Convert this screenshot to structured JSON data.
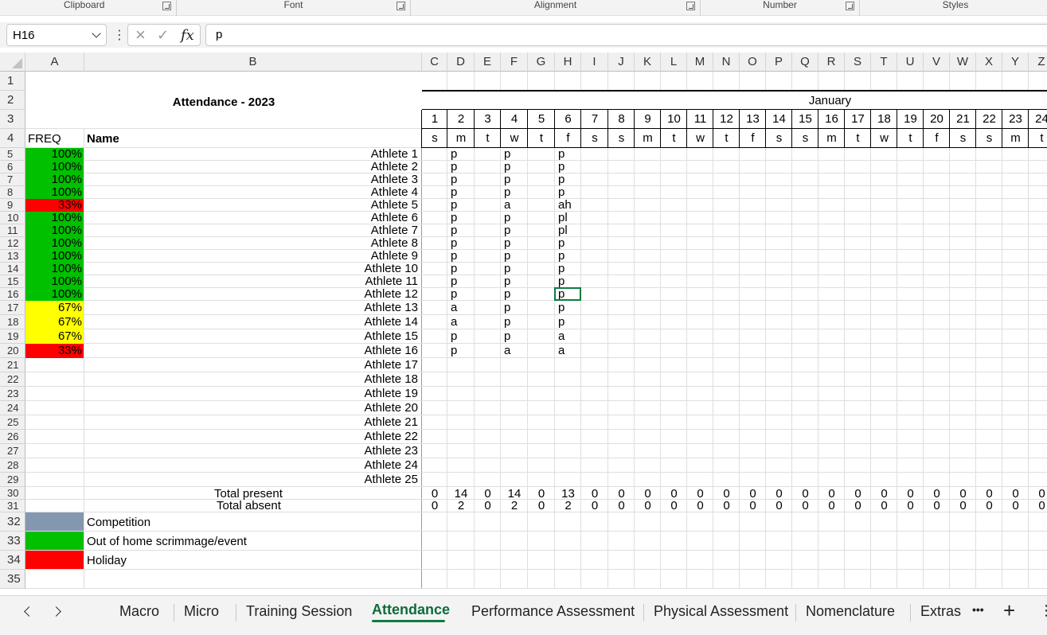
{
  "ribbon": {
    "groups": [
      {
        "label": "Clipboard"
      },
      {
        "label": "Font"
      },
      {
        "label": "Alignment"
      },
      {
        "label": "Number"
      },
      {
        "label": "Styles"
      }
    ]
  },
  "formula_bar": {
    "name_box": "H16",
    "more_icon": "⋮",
    "cancel_icon": "×",
    "enter_icon": "✓",
    "function_icon": "fx",
    "formula": "p"
  },
  "sheet": {
    "columns": [
      "A",
      "B",
      "C",
      "D",
      "E",
      "F",
      "G",
      "H",
      "I",
      "J",
      "K",
      "L",
      "M",
      "N",
      "O",
      "P",
      "Q",
      "R",
      "S",
      "T",
      "U",
      "V",
      "W",
      "X",
      "Y",
      "Z"
    ],
    "rows": [
      "1",
      "2",
      "3",
      "4",
      "5",
      "6",
      "7",
      "8",
      "9",
      "10",
      "11",
      "12",
      "13",
      "14",
      "15",
      "16",
      "17",
      "18",
      "19",
      "20",
      "21",
      "22",
      "23",
      "24",
      "25",
      "26",
      "27",
      "28",
      "29",
      "30",
      "31",
      "32",
      "33",
      "34",
      "35"
    ],
    "title": "Attendance - 2023",
    "month": "January",
    "days": [
      "1",
      "2",
      "3",
      "4",
      "5",
      "6",
      "7",
      "8",
      "9",
      "10",
      "11",
      "12",
      "13",
      "14",
      "15",
      "16",
      "17",
      "18",
      "19",
      "20",
      "21",
      "22",
      "23",
      "24"
    ],
    "weekdays": [
      "s",
      "m",
      "t",
      "w",
      "t",
      "f",
      "s",
      "s",
      "m",
      "t",
      "w",
      "t",
      "f",
      "s",
      "s",
      "m",
      "t",
      "w",
      "t",
      "f",
      "s",
      "s",
      "m",
      "t"
    ],
    "freq_header": "FREQ",
    "name_header": "Name",
    "athletes": [
      {
        "freq": "100%",
        "name": "Athlete 1",
        "d2": "p",
        "d4": "p",
        "d6": "p"
      },
      {
        "freq": "100%",
        "name": "Athlete 2",
        "d2": "p",
        "d4": "p",
        "d6": "p"
      },
      {
        "freq": "100%",
        "name": "Athlete 3",
        "d2": "p",
        "d4": "p",
        "d6": "p"
      },
      {
        "freq": "100%",
        "name": "Athlete 4",
        "d2": "p",
        "d4": "p",
        "d6": "p"
      },
      {
        "freq": "33%",
        "name": "Athlete 5",
        "d2": "p",
        "d4": "a",
        "d6": "ah"
      },
      {
        "freq": "100%",
        "name": "Athlete 6",
        "d2": "p",
        "d4": "p",
        "d6": "pl"
      },
      {
        "freq": "100%",
        "name": "Athlete 7",
        "d2": "p",
        "d4": "p",
        "d6": "pl"
      },
      {
        "freq": "100%",
        "name": "Athlete 8",
        "d2": "p",
        "d4": "p",
        "d6": "p"
      },
      {
        "freq": "100%",
        "name": "Athlete 9",
        "d2": "p",
        "d4": "p",
        "d6": "p"
      },
      {
        "freq": "100%",
        "name": "Athlete 10",
        "d2": "p",
        "d4": "p",
        "d6": "p"
      },
      {
        "freq": "100%",
        "name": "Athlete 11",
        "d2": "p",
        "d4": "p",
        "d6": "p"
      },
      {
        "freq": "100%",
        "name": "Athlete 12",
        "d2": "p",
        "d4": "p",
        "d6": "p"
      },
      {
        "freq": "67%",
        "name": "Athlete 13",
        "d2": "a",
        "d4": "p",
        "d6": "p"
      },
      {
        "freq": "67%",
        "name": "Athlete 14",
        "d2": "a",
        "d4": "p",
        "d6": "p"
      },
      {
        "freq": "67%",
        "name": "Athlete 15",
        "d2": "p",
        "d4": "p",
        "d6": "a"
      },
      {
        "freq": "33%",
        "name": "Athlete 16",
        "d2": "p",
        "d4": "a",
        "d6": "a"
      },
      {
        "freq": "",
        "name": "Athlete 17",
        "d2": "",
        "d4": "",
        "d6": ""
      },
      {
        "freq": "",
        "name": "Athlete 18",
        "d2": "",
        "d4": "",
        "d6": ""
      },
      {
        "freq": "",
        "name": "Athlete 19",
        "d2": "",
        "d4": "",
        "d6": ""
      },
      {
        "freq": "",
        "name": "Athlete 20",
        "d2": "",
        "d4": "",
        "d6": ""
      },
      {
        "freq": "",
        "name": "Athlete 21",
        "d2": "",
        "d4": "",
        "d6": ""
      },
      {
        "freq": "",
        "name": "Athlete 22",
        "d2": "",
        "d4": "",
        "d6": ""
      },
      {
        "freq": "",
        "name": "Athlete 23",
        "d2": "",
        "d4": "",
        "d6": ""
      },
      {
        "freq": "",
        "name": "Athlete 24",
        "d2": "",
        "d4": "",
        "d6": ""
      },
      {
        "freq": "",
        "name": "Athlete 25",
        "d2": "",
        "d4": "",
        "d6": ""
      }
    ],
    "total_present_label": "Total present",
    "total_absent_label": "Total absent",
    "total_present": [
      "0",
      "14",
      "0",
      "14",
      "0",
      "13",
      "0",
      "0",
      "0",
      "0",
      "0",
      "0",
      "0",
      "0",
      "0",
      "0",
      "0",
      "0",
      "0",
      "0",
      "0",
      "0",
      "0",
      "0"
    ],
    "total_absent": [
      "0",
      "2",
      "0",
      "2",
      "0",
      "2",
      "0",
      "0",
      "0",
      "0",
      "0",
      "0",
      "0",
      "0",
      "0",
      "0",
      "0",
      "0",
      "0",
      "0",
      "0",
      "0",
      "0",
      "0"
    ],
    "legend": [
      {
        "label": "Competition",
        "color": "#8497b0"
      },
      {
        "label": "Out of home scrimmage/event",
        "color": "#00c000"
      },
      {
        "label": "Holiday",
        "color": "#ff0000"
      }
    ],
    "colors": {
      "green": "#00c000",
      "yellow": "#ffff00",
      "red": "#ff0000",
      "grey": "#8497b0"
    }
  },
  "tabs": {
    "prev_icon": "chevron-left-icon",
    "next_icon": "chevron-right-icon",
    "items": [
      "Macro",
      "Micro",
      "Training Session",
      "Attendance",
      "Performance Assessment",
      "Physical Assessment",
      "Nomenclature",
      "Extras"
    ],
    "active": "Attendance",
    "more": "•••",
    "add": "+",
    "options": "⋮"
  }
}
